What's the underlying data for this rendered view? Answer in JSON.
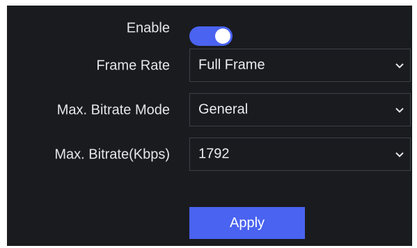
{
  "form": {
    "enable": {
      "label": "Enable",
      "state": true
    },
    "frame_rate": {
      "label": "Frame Rate",
      "value": "Full Frame"
    },
    "bitrate_mode": {
      "label": "Max. Bitrate Mode",
      "value": "General"
    },
    "bitrate": {
      "label": "Max. Bitrate(Kbps)",
      "value": "1792"
    },
    "apply_label": "Apply"
  },
  "colors": {
    "panel_background": "#191b1f",
    "accent": "#4a63f0",
    "field_border": "#3d4046",
    "text": "#e6e6e8"
  },
  "icons": {
    "dropdown": "chevron-down-icon"
  }
}
